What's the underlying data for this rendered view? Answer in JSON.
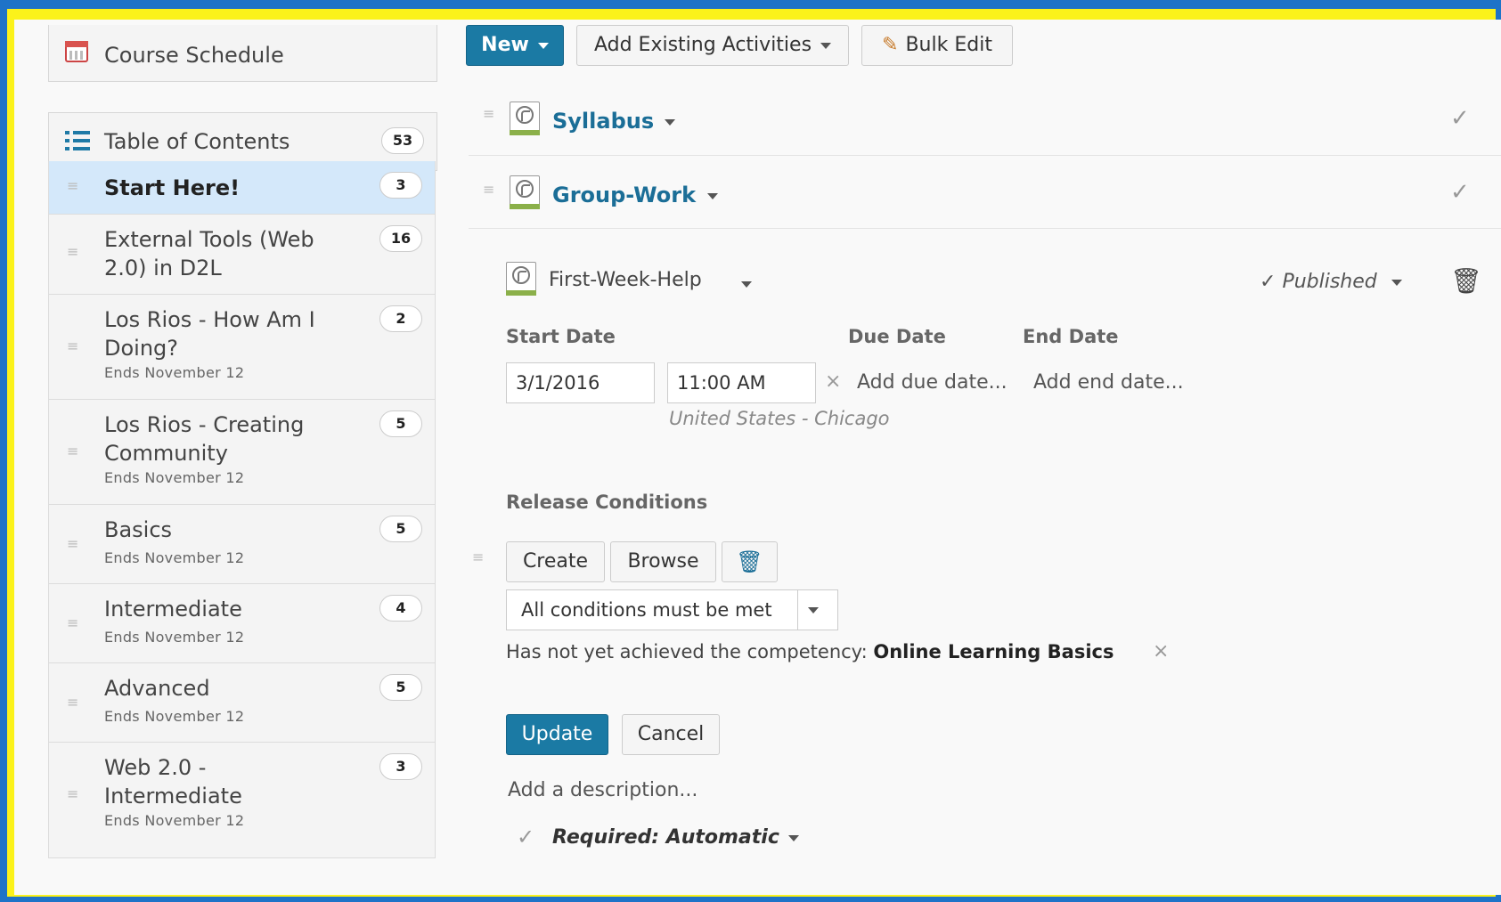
{
  "sidebar": {
    "course_schedule": "Course Schedule",
    "toc": {
      "label": "Table of Contents",
      "count": "53"
    },
    "modules": [
      {
        "title": "Start Here!",
        "count": "3",
        "ends": "",
        "selected": true
      },
      {
        "title": "External Tools (Web 2.0) in D2L",
        "count": "16",
        "ends": ""
      },
      {
        "title": "Los Rios - How Am I Doing?",
        "count": "2",
        "ends": "Ends November 12"
      },
      {
        "title": "Los Rios - Creating Community",
        "count": "5",
        "ends": "Ends November 12"
      },
      {
        "title": "Basics",
        "count": "5",
        "ends": "Ends November 12"
      },
      {
        "title": "Intermediate",
        "count": "4",
        "ends": "Ends November 12"
      },
      {
        "title": "Advanced",
        "count": "5",
        "ends": "Ends November 12"
      },
      {
        "title": "Web 2.0 - Intermediate",
        "count": "3",
        "ends": "Ends November 12"
      }
    ]
  },
  "toolbar": {
    "new_label": "New",
    "add_existing_label": "Add Existing Activities",
    "bulk_edit_label": "Bulk Edit"
  },
  "topics": [
    {
      "title": "Syllabus"
    },
    {
      "title": "Group-Work"
    }
  ],
  "editing": {
    "title": "First-Week-Help",
    "status": "Published",
    "start_date_label": "Start Date",
    "due_date_label": "Due Date",
    "end_date_label": "End Date",
    "start_date_value": "3/1/2016",
    "start_time_value": "11:00 AM",
    "add_due_date": "Add due date...",
    "add_end_date": "Add end date...",
    "timezone": "United States - Chicago",
    "release_conditions_label": "Release Conditions",
    "create_label": "Create",
    "browse_label": "Browse",
    "condition_mode": "All conditions must be met",
    "condition_prefix": "Has not yet achieved the competency:",
    "condition_target": "Online Learning Basics",
    "update_label": "Update",
    "cancel_label": "Cancel",
    "add_description": "Add a description...",
    "required_label": "Required: Automatic"
  },
  "colors": {
    "accent": "#1b7aa4",
    "selected_row": "#d4e8fa",
    "frame_yellow": "#fbf21a",
    "frame_blue": "#1e73c8"
  }
}
